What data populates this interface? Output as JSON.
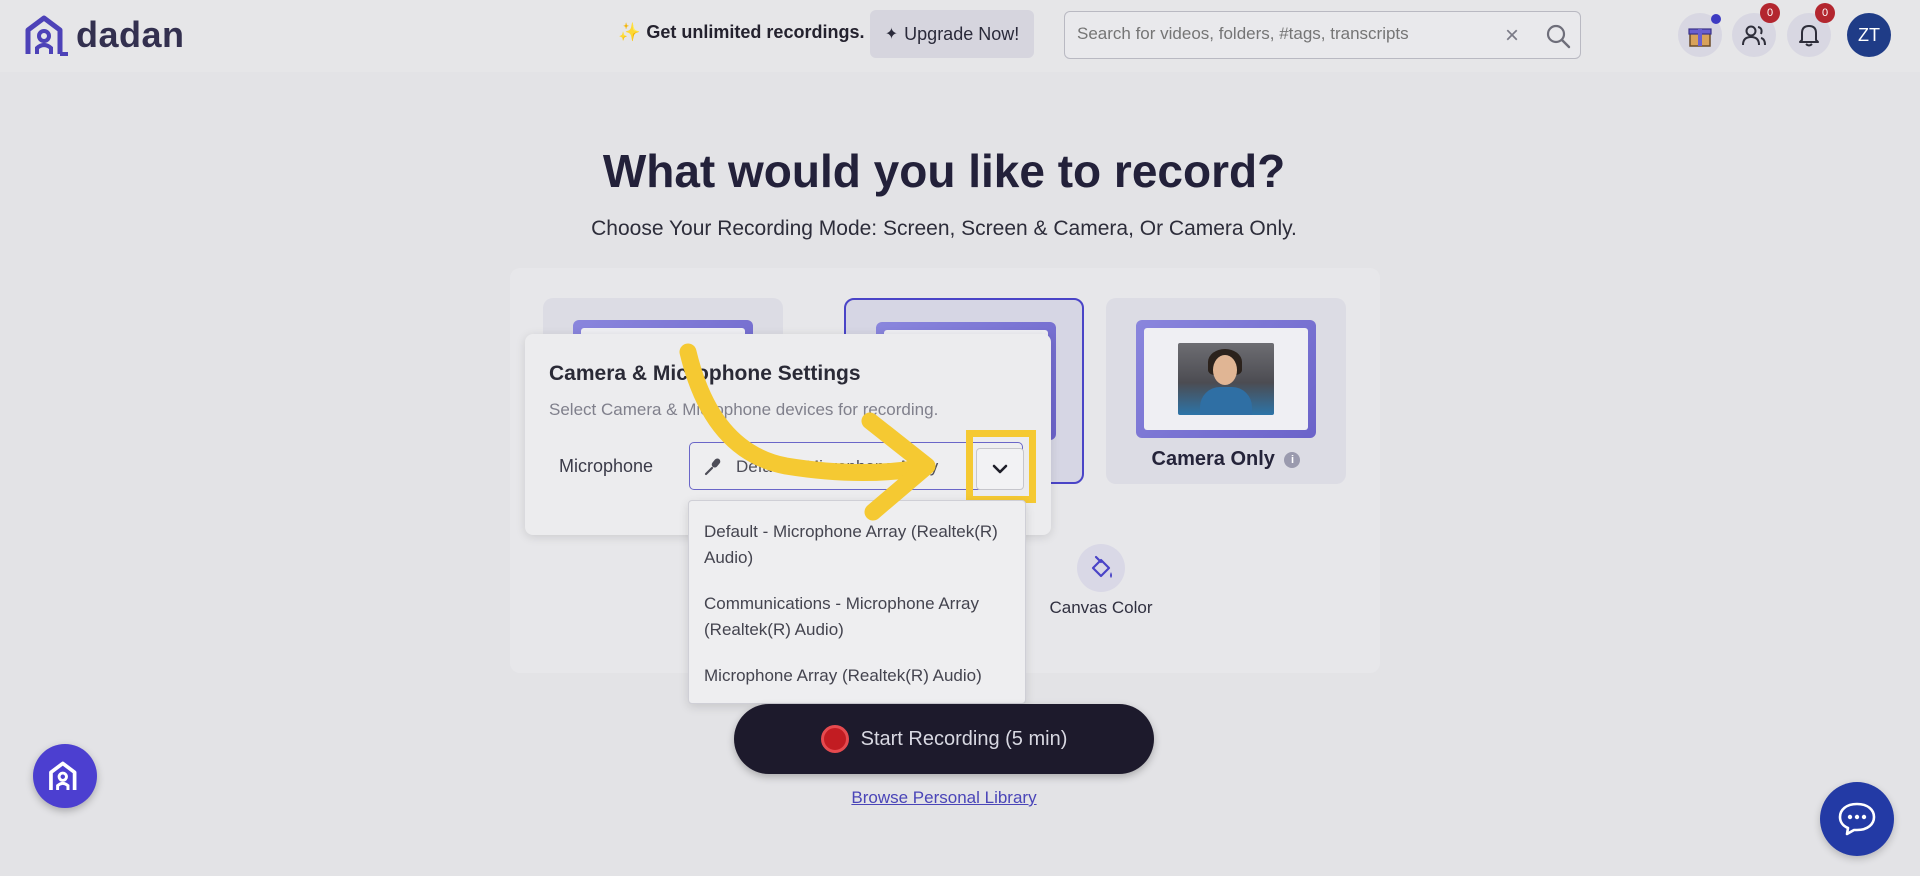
{
  "header": {
    "logo_text": "dadan",
    "promo_text": "Get unlimited recordings.",
    "upgrade_label": "Upgrade Now!",
    "search_placeholder": "Search for videos, folders, #tags, transcripts",
    "icons": [
      "gift-icon",
      "users-icon",
      "bell-icon"
    ],
    "team_badge": "0",
    "notification_badge": "0",
    "avatar_initials": "ZT"
  },
  "main": {
    "title": "What would you like to record?",
    "subtitle": "Choose Your Recording Mode: Screen, Screen & Camera, Or Camera Only.",
    "modes": [
      {
        "label": "",
        "selected": false
      },
      {
        "label": "",
        "selected": true
      },
      {
        "label": "Camera Only",
        "selected": false
      }
    ],
    "tools": [
      {
        "label": "Canvas Color",
        "icon": "paint-bucket-icon"
      }
    ]
  },
  "settings": {
    "title": "Camera & Microphone Settings",
    "subtitle": "Select Camera & Microphone devices for recording.",
    "microphone_label": "Microphone",
    "microphone_value": "Default - Microphone Array",
    "options": [
      "Default - Microphone Array (Realtek(R) Audio)",
      "Communications - Microphone Array (Realtek(R) Audio)",
      "Microphone Array (Realtek(R) Audio)"
    ]
  },
  "actions": {
    "start_label": "Start Recording (5 min)",
    "browse_label": "Browse Personal Library"
  },
  "colors": {
    "accent": "#4a44c7",
    "highlight": "#f5c932",
    "record": "#c21c22",
    "dark_button": "#1d1a2c"
  }
}
